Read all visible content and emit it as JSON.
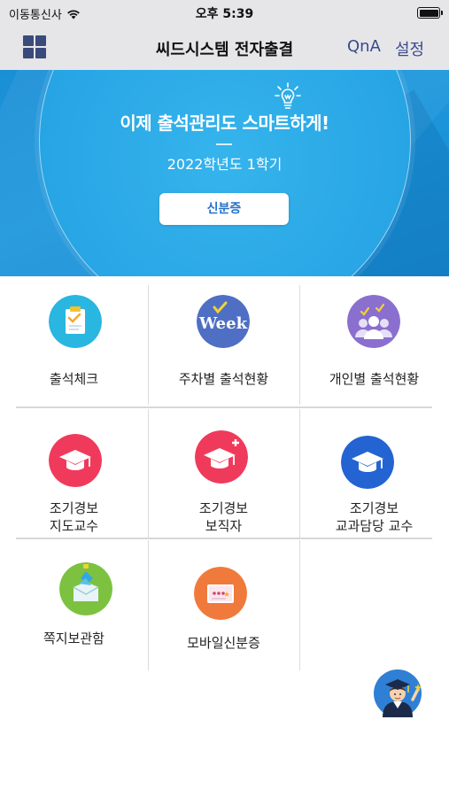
{
  "status_bar": {
    "carrier": "이동통신사",
    "time": "오후 5:39"
  },
  "nav": {
    "title": "씨드시스템 전자출결",
    "qna": "QnA",
    "settings": "설정"
  },
  "banner": {
    "headline": "이제 출석관리도 스마트하게!",
    "term": "2022학년도 1학기",
    "id_card_button": "신분증"
  },
  "menu": {
    "items": [
      {
        "label": "출석체크",
        "icon": "clipboard-check-icon",
        "color": "#29b6e0"
      },
      {
        "label": "주차별 출석현황",
        "icon": "weekly-icon",
        "color": "#4f6fc4"
      },
      {
        "label": "개인별 출석현황",
        "icon": "people-check-icon",
        "color": "#8b6fcf"
      },
      {
        "label_line1": "조기경보",
        "label_line2": "지도교수",
        "icon": "graduation-cap-icon",
        "color": "#f03a5c"
      },
      {
        "label_line1": "조기경보",
        "label_line2": "보직자",
        "icon": "graduation-cap-plus-icon",
        "color": "#f03a5c"
      },
      {
        "label_line1": "조기경보",
        "label_line2": "교과담당 교수",
        "icon": "graduation-cap-icon",
        "color": "#2364d2"
      },
      {
        "label": "쪽지보관함",
        "icon": "message-box-icon",
        "color": "#7cc240"
      },
      {
        "label": "모바일신분증",
        "icon": "mobile-id-card-icon",
        "color": "#f07a3c"
      }
    ]
  },
  "floating": {
    "icon": "graduate-avatar-icon"
  }
}
